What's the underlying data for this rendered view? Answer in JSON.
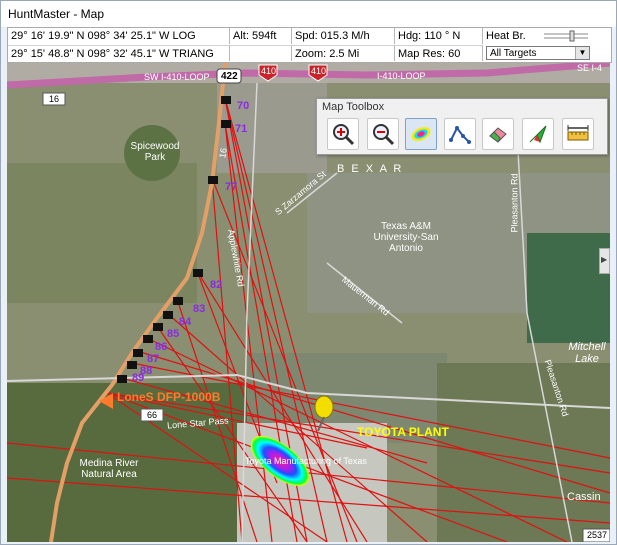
{
  "window": {
    "title": "HuntMaster - Map"
  },
  "info": {
    "row1": {
      "position": "29° 16' 19.9\" N    098° 34' 25.1\" W  LOG",
      "altitude": "Alt: 594ft",
      "speed": "Spd: 015.3 M/h",
      "heading": "Hdg:  110 °  N",
      "heat_label": "Heat Br."
    },
    "row2": {
      "position": "29° 15' 48.8\" N    098° 32' 45.1\" W TRIANG",
      "zoom": "Zoom: 2.5 Mi",
      "map_res": "Map Res:  60",
      "target_select": "All Targets"
    }
  },
  "toolbox": {
    "title": "Map Toolbox",
    "buttons": [
      {
        "name": "zoom-in-button",
        "icon": "zoom-in-icon"
      },
      {
        "name": "zoom-out-button",
        "icon": "zoom-out-icon"
      },
      {
        "name": "heatmap-button",
        "icon": "heatmap-icon"
      },
      {
        "name": "route-button",
        "icon": "route-icon"
      },
      {
        "name": "eraser-button",
        "icon": "eraser-icon"
      },
      {
        "name": "direction-arrow-button",
        "icon": "cursor-arrow-icon"
      },
      {
        "name": "measure-button",
        "icon": "ruler-icon"
      }
    ]
  },
  "map": {
    "roads": {
      "loop_left": "SW I-410-LOOP",
      "loop_right": "I-410-LOOP",
      "loop_far": "SE I-4",
      "hwy_16": "16",
      "shield_422": "422",
      "shield_410a": "410",
      "shield_410b": "410",
      "road_16": "16",
      "shield_66": "66",
      "applewhite": "Applewhite Rd",
      "zarzamora": "S Zarzamora St",
      "mauerman": "Mauerman Rd",
      "pleasanton_top": "Pleasanton Rd",
      "pleasanton_bottom": "Pleasanton Rd",
      "lone_star": "Lone Star Pass",
      "spur_2537": "2537"
    },
    "places": {
      "spicewood": "Spicewood Park",
      "bexar": "B E X A R",
      "tamu": "Texas A&M University-San Antonio",
      "mitchell": "Mitchell Lake",
      "medina": "Medina River Natural Area",
      "cassin": "Cassin",
      "toyota_plant": "TOYOTA PLANT",
      "toyota_mfg": "Toyota Manufacturing of Texas",
      "device": "LoneS DFP-1000B"
    },
    "markers": [
      "70",
      "71",
      "77",
      "82",
      "83",
      "84",
      "85",
      "86",
      "87",
      "88",
      "89"
    ],
    "colors": {
      "marker_text": "#8b2be2",
      "lines": "#e01010",
      "road": "#e3a066",
      "loop": "#c06aa8",
      "plant_label": "#ffff00"
    }
  }
}
